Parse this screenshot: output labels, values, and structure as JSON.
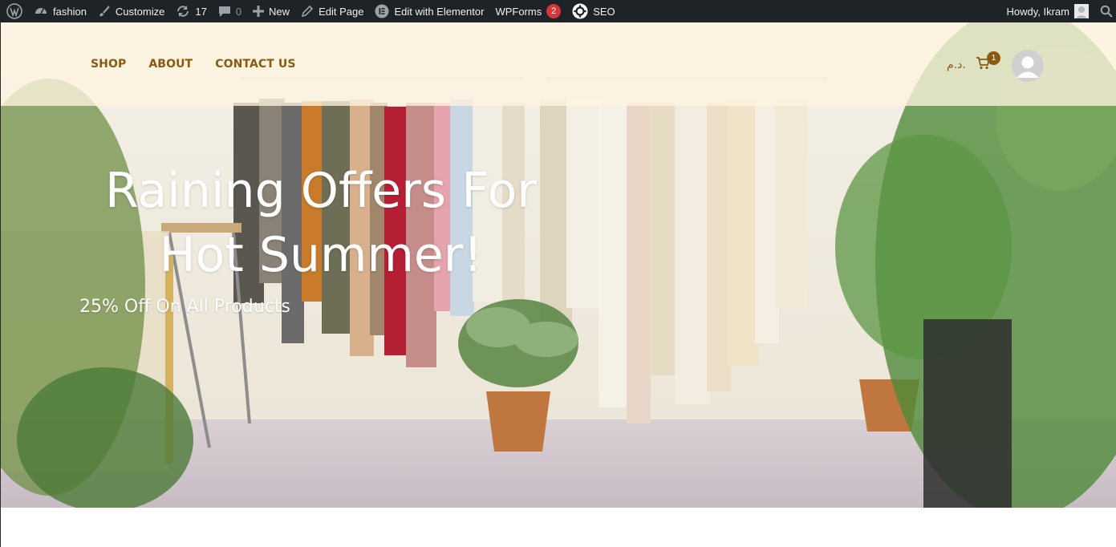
{
  "admin_bar": {
    "site_name": "fashion",
    "customize": "Customize",
    "updates_count": "17",
    "comments_count": "0",
    "new": "New",
    "edit_page": "Edit Page",
    "edit_elementor": "Edit with Elementor",
    "wpforms": "WPForms",
    "wpforms_badge": "2",
    "seo": "SEO",
    "howdy": "Howdy, Ikram"
  },
  "header": {
    "nav": [
      "SHOP",
      "ABOUT",
      "CONTACT US"
    ],
    "currency": "د.م.",
    "cart_count": "1"
  },
  "hero": {
    "title_line1": "Raining Offers For",
    "title_line2": "Hot Summer!",
    "subtitle": "25% Off On All Products"
  },
  "colors": {
    "admin_bar_bg": "#1d2327",
    "accent": "#8a5a12",
    "badge": "#d63638"
  },
  "icons": [
    "wordpress-icon",
    "dashboard-icon",
    "paintbrush-icon",
    "updates-icon",
    "comment-icon",
    "plus-icon",
    "pencil-icon",
    "elementor-icon",
    "seo-icon",
    "search-icon",
    "cart-icon",
    "user-avatar-icon"
  ]
}
